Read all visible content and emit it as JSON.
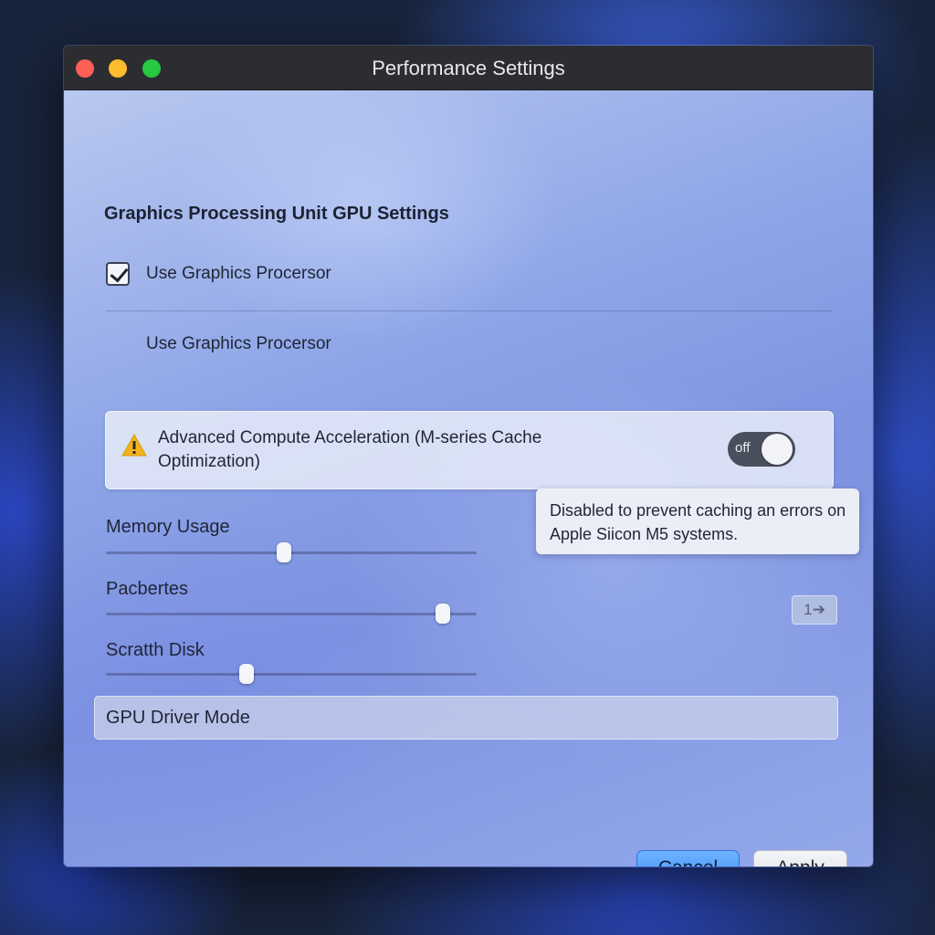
{
  "window": {
    "title": "Performance Settings"
  },
  "gpu": {
    "section_title": "Graphics Processing Unit GPU Settings",
    "use_gpu_label": "Use Graphics Procersor",
    "use_gpu_checked": true,
    "sub_label": "Use Graphics Procersor"
  },
  "advanced": {
    "label": "Advanced Compute Acceleration (M-series Cache Optimization)",
    "toggle_text": "off",
    "toggle_on": false,
    "tooltip": "Disabled to prevent caching an errors on Apple Siicon M5 systems."
  },
  "sliders": [
    {
      "label": "Memory Usage",
      "value": 0.48
    },
    {
      "label": "Pacbertes",
      "value": 0.91
    },
    {
      "label": "Scratth Disk",
      "value": 0.38
    }
  ],
  "step_badge": "1➔",
  "driver_mode": {
    "label": "GPU Driver Mode"
  },
  "buttons": {
    "cancel": "Cancel",
    "apply": "Apply"
  },
  "colors": {
    "accent": "#3d8ef7",
    "close": "#ff5f57",
    "minimize": "#febc2e",
    "zoom": "#28c840",
    "warning": "#f5b31a"
  }
}
